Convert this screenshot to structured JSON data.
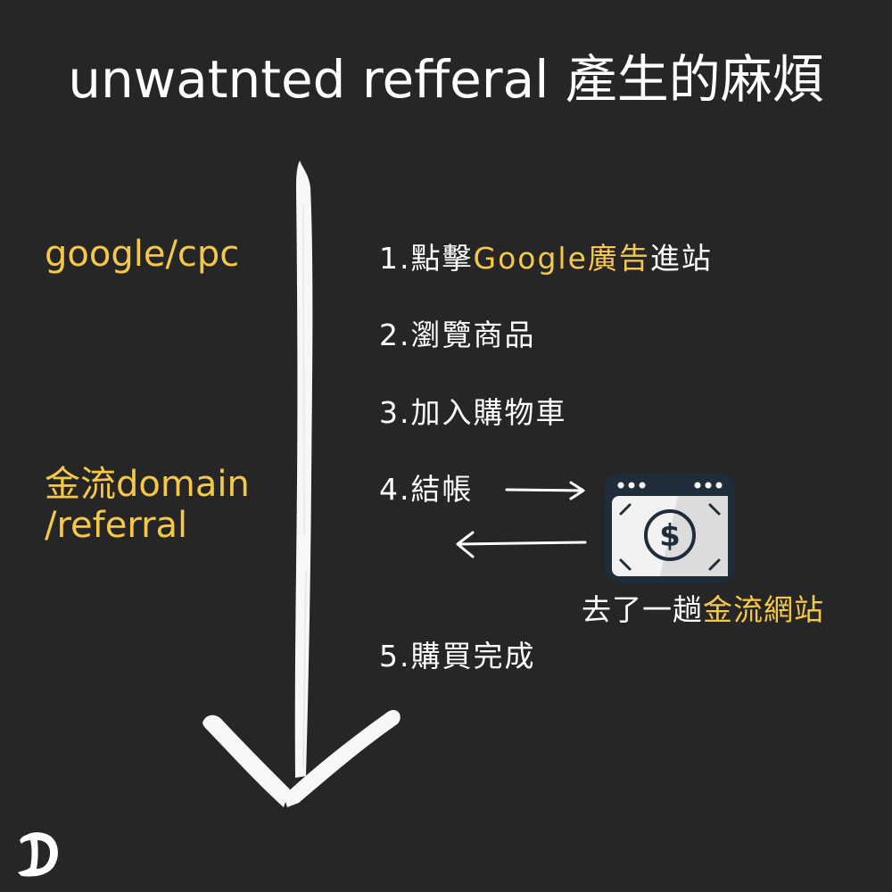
{
  "title": "unwatnted refferal 產生的麻煩",
  "left_labels": {
    "source_top": "google/cpc",
    "source_bottom_line1": "金流domain",
    "source_bottom_line2": "/referral"
  },
  "steps": {
    "step1": {
      "prefix": "1.點擊",
      "highlight": "Google廣告",
      "suffix": "進站"
    },
    "step2": "2.瀏覽商品",
    "step3": "3.加入購物車",
    "step4": "4.結帳",
    "step5": "5.購買完成"
  },
  "payment_caption": {
    "prefix": "去了一趟",
    "highlight": "金流網站"
  },
  "colors": {
    "background": "#262626",
    "text": "#ffffff",
    "highlight": "#f5c84a"
  },
  "icons": {
    "payment_site": "payment-window-dollar-icon",
    "logo": "d-logo-icon"
  }
}
